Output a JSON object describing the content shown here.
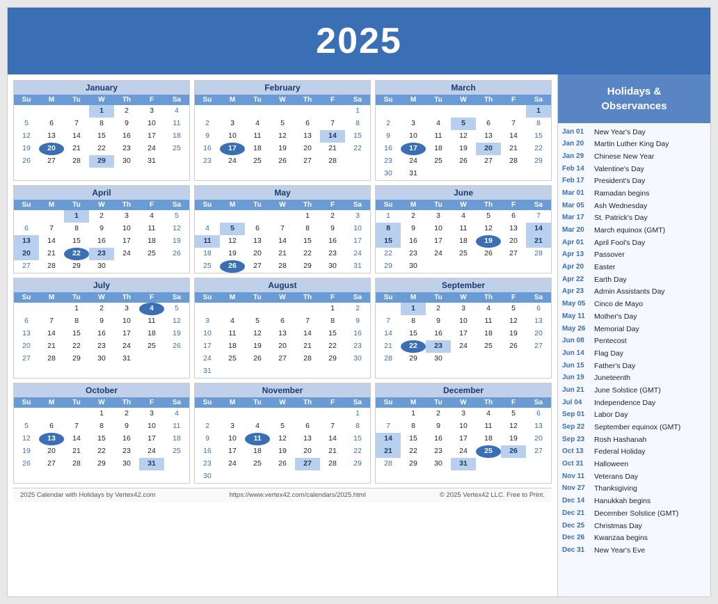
{
  "header": {
    "year": "2025"
  },
  "sidebar": {
    "title": "Holidays &\nObservances",
    "holidays": [
      {
        "date": "Jan 01",
        "name": "New Year's Day"
      },
      {
        "date": "Jan 20",
        "name": "Martin Luther King Day"
      },
      {
        "date": "Jan 29",
        "name": "Chinese New Year"
      },
      {
        "date": "Feb 14",
        "name": "Valentine's Day"
      },
      {
        "date": "Feb 17",
        "name": "President's Day"
      },
      {
        "date": "Mar 01",
        "name": "Ramadan begins"
      },
      {
        "date": "Mar 05",
        "name": "Ash Wednesday"
      },
      {
        "date": "Mar 17",
        "name": "St. Patrick's Day"
      },
      {
        "date": "Mar 20",
        "name": "March equinox (GMT)"
      },
      {
        "date": "Apr 01",
        "name": "April Fool's Day"
      },
      {
        "date": "Apr 13",
        "name": "Passover"
      },
      {
        "date": "Apr 20",
        "name": "Easter"
      },
      {
        "date": "Apr 22",
        "name": "Earth Day"
      },
      {
        "date": "Apr 23",
        "name": "Admin Assistants Day"
      },
      {
        "date": "May 05",
        "name": "Cinco de Mayo"
      },
      {
        "date": "May 11",
        "name": "Mother's Day"
      },
      {
        "date": "May 26",
        "name": "Memorial Day"
      },
      {
        "date": "Jun 08",
        "name": "Pentecost"
      },
      {
        "date": "Jun 14",
        "name": "Flag Day"
      },
      {
        "date": "Jun 15",
        "name": "Father's Day"
      },
      {
        "date": "Jun 19",
        "name": "Juneteenth"
      },
      {
        "date": "Jun 21",
        "name": "June Solstice (GMT)"
      },
      {
        "date": "Jul 04",
        "name": "Independence Day"
      },
      {
        "date": "Sep 01",
        "name": "Labor Day"
      },
      {
        "date": "Sep 22",
        "name": "September equinox (GMT)"
      },
      {
        "date": "Sep 23",
        "name": "Rosh Hashanah"
      },
      {
        "date": "Oct 13",
        "name": "Federal Holiday"
      },
      {
        "date": "Oct 31",
        "name": "Halloween"
      },
      {
        "date": "Nov 11",
        "name": "Veterans Day"
      },
      {
        "date": "Nov 27",
        "name": "Thanksgiving"
      },
      {
        "date": "Dec 14",
        "name": "Hanukkah begins"
      },
      {
        "date": "Dec 21",
        "name": "December Solstice (GMT)"
      },
      {
        "date": "Dec 25",
        "name": "Christmas Day"
      },
      {
        "date": "Dec 26",
        "name": "Kwanzaa begins"
      },
      {
        "date": "Dec 31",
        "name": "New Year's Eve"
      }
    ]
  },
  "footer": {
    "left": "2025 Calendar with Holidays by Vertex42.com",
    "center": "https://www.vertex42.com/calendars/2025.html",
    "right": "© 2025 Vertex42 LLC. Free to Print."
  },
  "months": [
    {
      "name": "January",
      "offset": 3,
      "days": 31,
      "highlights": [
        1,
        20,
        29
      ],
      "today": 20
    },
    {
      "name": "February",
      "offset": 6,
      "days": 28,
      "highlights": [
        14,
        17
      ],
      "today": 17
    },
    {
      "name": "March",
      "offset": 6,
      "days": 31,
      "highlights": [
        1,
        5,
        17,
        20
      ],
      "today": 17
    },
    {
      "name": "April",
      "offset": 2,
      "days": 30,
      "highlights": [
        1,
        13,
        20,
        22,
        23
      ],
      "today": 22
    },
    {
      "name": "May",
      "offset": 4,
      "days": 31,
      "highlights": [
        5,
        11,
        26
      ],
      "today": 26
    },
    {
      "name": "June",
      "offset": 0,
      "days": 30,
      "highlights": [
        8,
        14,
        15,
        19,
        21
      ],
      "today": 19
    },
    {
      "name": "July",
      "offset": 2,
      "days": 31,
      "highlights": [
        4
      ],
      "today": 4
    },
    {
      "name": "August",
      "offset": 5,
      "days": 31,
      "highlights": [],
      "today": null
    },
    {
      "name": "September",
      "offset": 1,
      "days": 30,
      "highlights": [
        1,
        22,
        23
      ],
      "today": 22
    },
    {
      "name": "October",
      "offset": 3,
      "days": 31,
      "highlights": [
        13,
        31
      ],
      "today": 13
    },
    {
      "name": "November",
      "offset": 6,
      "days": 30,
      "highlights": [
        11,
        27
      ],
      "today": 11
    },
    {
      "name": "December",
      "offset": 1,
      "days": 31,
      "highlights": [
        14,
        21,
        25,
        26,
        31
      ],
      "today": 25
    }
  ]
}
